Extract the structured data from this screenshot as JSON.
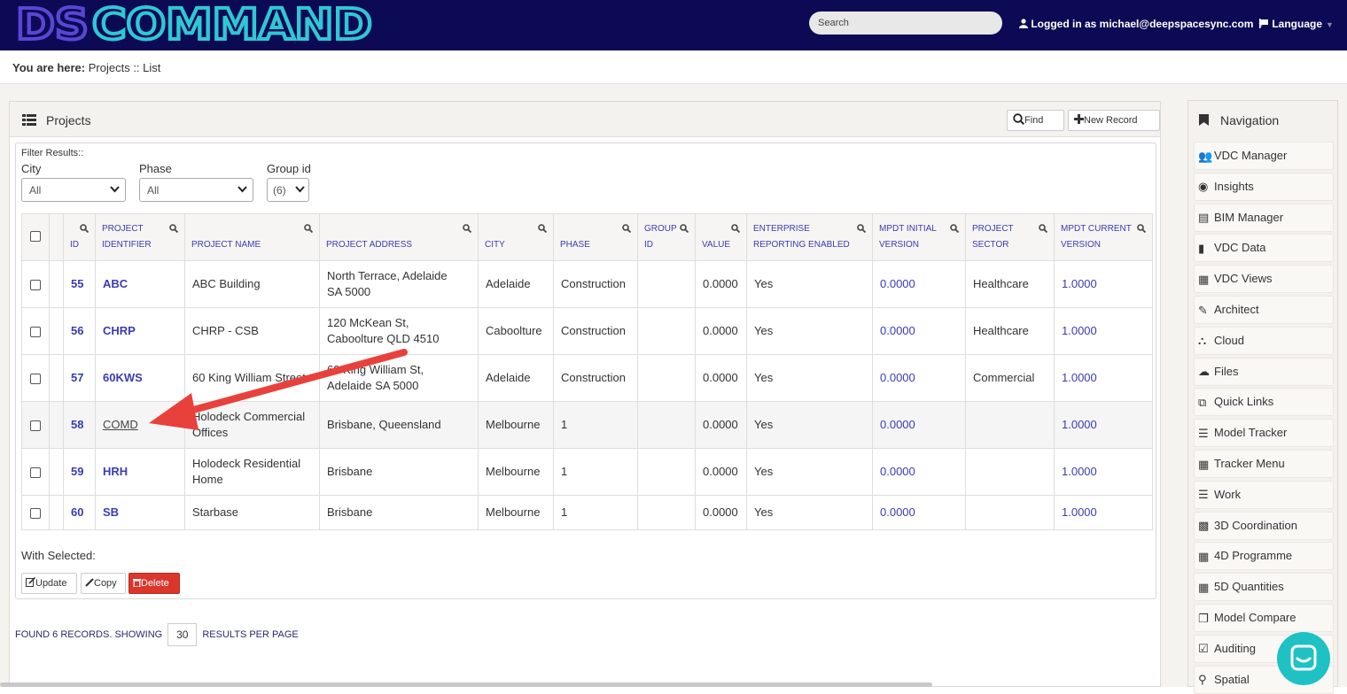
{
  "header": {
    "logo_text": "DSCOMMAND",
    "search_placeholder": "Search",
    "login_text": "Logged in as michael@deepspacesync.com",
    "language_label": "Language"
  },
  "breadcrumb": {
    "prefix": "You are here:",
    "path": "Projects :: List"
  },
  "panel": {
    "title": "Projects",
    "find_label": "Find",
    "new_record_label": "New Record",
    "filter_title": "Filter Results::",
    "filters": [
      {
        "label": "City",
        "value": "All"
      },
      {
        "label": "Phase",
        "value": "All"
      },
      {
        "label": "Group id",
        "value": "(6)"
      }
    ]
  },
  "table": {
    "columns": [
      [
        "ID"
      ],
      [
        "PROJECT",
        "IDENTIFIER"
      ],
      [
        "PROJECT NAME"
      ],
      [
        "PROJECT ADDRESS"
      ],
      [
        "CITY"
      ],
      [
        "PHASE"
      ],
      [
        "GROUP",
        "ID"
      ],
      [
        "VALUE"
      ],
      [
        "ENTERPRISE",
        "REPORTING ENABLED"
      ],
      [
        "MPDT INITIAL",
        "VERSION"
      ],
      [
        "PROJECT",
        "SECTOR"
      ],
      [
        "MPDT CURRENT",
        "VERSION"
      ]
    ],
    "rows": [
      {
        "id": "55",
        "identifier": "ABC",
        "name": [
          "ABC Building"
        ],
        "address": [
          "North Terrace, Adelaide",
          "SA 5000"
        ],
        "city": "Adelaide",
        "phase": "Construction",
        "group_id": "",
        "value": "0.0000",
        "enterprise": "Yes",
        "mpdt_initial": "0.0000",
        "sector": "Healthcare",
        "mpdt_current": "1.0000"
      },
      {
        "id": "56",
        "identifier": "CHRP",
        "name": [
          "CHRP - CSB"
        ],
        "address": [
          "120 McKean St,",
          "Caboolture QLD 4510"
        ],
        "city": "Caboolture",
        "phase": "Construction",
        "group_id": "",
        "value": "0.0000",
        "enterprise": "Yes",
        "mpdt_initial": "0.0000",
        "sector": "Healthcare",
        "mpdt_current": "1.0000"
      },
      {
        "id": "57",
        "identifier": "60KWS",
        "name": [
          "60 King William Street"
        ],
        "address": [
          "60 King William St,",
          "Adelaide SA 5000"
        ],
        "city": "Adelaide",
        "phase": "Construction",
        "group_id": "",
        "value": "0.0000",
        "enterprise": "Yes",
        "mpdt_initial": "0.0000",
        "sector": "Commercial",
        "mpdt_current": "1.0000"
      },
      {
        "id": "58",
        "identifier": "COMD",
        "name": [
          "Holodeck Commercial",
          "Offices"
        ],
        "address": [
          "Brisbane, Queensland"
        ],
        "city": "Melbourne",
        "phase": "1",
        "group_id": "",
        "value": "0.0000",
        "enterprise": "Yes",
        "mpdt_initial": "0.0000",
        "sector": "",
        "mpdt_current": "1.0000"
      },
      {
        "id": "59",
        "identifier": "HRH",
        "name": [
          "Holodeck Residential",
          "Home"
        ],
        "address": [
          "Brisbane"
        ],
        "city": "Melbourne",
        "phase": "1",
        "group_id": "",
        "value": "0.0000",
        "enterprise": "Yes",
        "mpdt_initial": "0.0000",
        "sector": "",
        "mpdt_current": "1.0000"
      },
      {
        "id": "60",
        "identifier": "SB",
        "name": [
          "Starbase"
        ],
        "address": [
          "Brisbane"
        ],
        "city": "Melbourne",
        "phase": "1",
        "group_id": "",
        "value": "0.0000",
        "enterprise": "Yes",
        "mpdt_initial": "0.0000",
        "sector": "",
        "mpdt_current": "1.0000"
      }
    ]
  },
  "actions": {
    "with_selected": "With Selected:",
    "update": "Update",
    "copy": "Copy",
    "delete": "Delete"
  },
  "footer": {
    "found_prefix": "FOUND 6 RECORDS. SHOWING",
    "per_page": "30",
    "found_suffix": "RESULTS PER PAGE"
  },
  "navigation": {
    "title": "Navigation",
    "items": [
      {
        "label": "VDC Manager",
        "icon": "users-icon"
      },
      {
        "label": "Insights",
        "icon": "dashboard-icon"
      },
      {
        "label": "BIM Manager",
        "icon": "list-alt-icon"
      },
      {
        "label": "VDC Data",
        "icon": "book-icon"
      },
      {
        "label": "VDC Views",
        "icon": "film-icon"
      },
      {
        "label": "Architect",
        "icon": "pencil-icon"
      },
      {
        "label": "Cloud",
        "icon": "sitemap-icon"
      },
      {
        "label": "Files",
        "icon": "cloud-icon"
      },
      {
        "label": "Quick Links",
        "icon": "external-link-icon"
      },
      {
        "label": "Model Tracker",
        "icon": "list-icon"
      },
      {
        "label": "Tracker Menu",
        "icon": "grid-icon"
      },
      {
        "label": "Work",
        "icon": "list-ul-icon"
      },
      {
        "label": "3D Coordination",
        "icon": "qrcode-icon"
      },
      {
        "label": "4D Programme",
        "icon": "calendar-icon"
      },
      {
        "label": "5D Quantities",
        "icon": "table-icon"
      },
      {
        "label": "Model Compare",
        "icon": "clone-icon"
      },
      {
        "label": "Auditing",
        "icon": "check-square-icon"
      },
      {
        "label": "Spatial",
        "icon": "map-marker-icon"
      }
    ]
  },
  "colors": {
    "topbar": "#0c0a55",
    "logo_ds": "#5a46d4",
    "logo_command": "#2ec8d4",
    "link": "#3b3bb5",
    "delete": "#d9362c",
    "chat": "#1ec1c4",
    "annotation_arrow": "#e8413c"
  }
}
